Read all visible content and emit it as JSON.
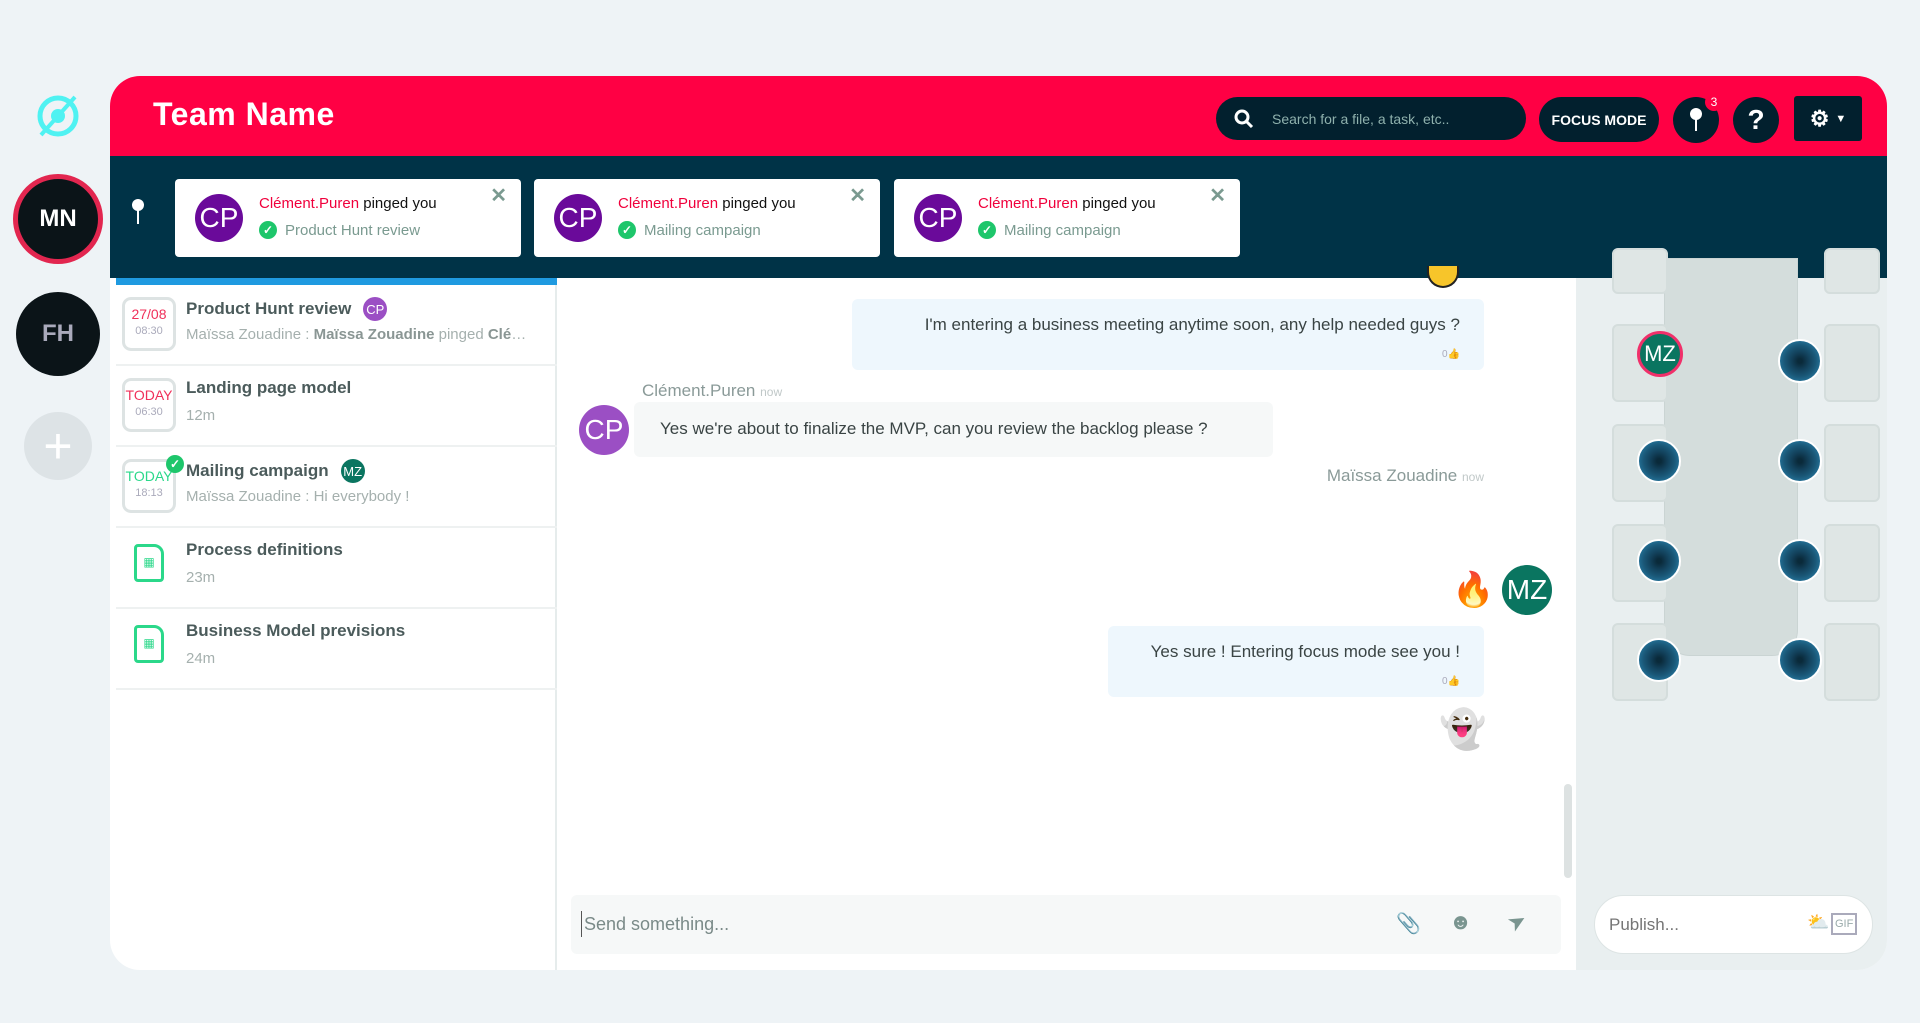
{
  "rail": {
    "workspaces": [
      {
        "initials": "MN",
        "active": true
      },
      {
        "initials": "FH",
        "active": false
      }
    ],
    "add_label": "+"
  },
  "header": {
    "title": "Team Name",
    "search_placeholder": "Search for a file, a task, etc..",
    "focus_label": "FOCUS MODE",
    "ping_count": "3",
    "help_label": "?"
  },
  "pings": [
    {
      "initials": "CP",
      "user": "Clément.Puren",
      "action": "pinged you",
      "topic": "Product Hunt review"
    },
    {
      "initials": "CP",
      "user": "Clément.Puren",
      "action": "pinged you",
      "topic": "Mailing campaign"
    },
    {
      "initials": "CP",
      "user": "Clément.Puren",
      "action": "pinged you",
      "topic": "Mailing campaign"
    }
  ],
  "list": [
    {
      "date": "27/08",
      "time": "08:30",
      "title": "Product Hunt review",
      "badge": "CP",
      "sub_user": "Maïssa Zouadine : ",
      "sub_bold": "Maïssa Zouadine",
      "sub_mid": " pinged ",
      "sub_end": "Clém..."
    },
    {
      "date": "TODAY",
      "time": "06:30",
      "title": "Landing page model",
      "sub": "12m"
    },
    {
      "date": "TODAY",
      "time": "18:13",
      "title": "Mailing campaign",
      "badge": "MZ",
      "sub": "Maïssa Zouadine : Hi everybody !"
    },
    {
      "title": "Process definitions",
      "sub": "23m"
    },
    {
      "title": "Business Model previsions",
      "sub": "24m"
    }
  ],
  "messages": [
    {
      "text": "I'm entering a business meeting anytime soon, any help needed guys ?",
      "likes": "0"
    },
    {
      "author": "Clément.Puren",
      "time": "now",
      "initials": "CP",
      "text": "Yes we're about to finalize the MVP, can you review the backlog please ?"
    },
    {
      "author": "Maïssa Zouadine",
      "time": "now",
      "initials": "MZ",
      "emoji": "🔥"
    },
    {
      "text": "Yes sure ! Entering focus mode see you !",
      "likes": "0",
      "emoji": "👻"
    }
  ],
  "composer": {
    "placeholder": "Send something..."
  },
  "room": {
    "occupant": "MZ",
    "publish_placeholder": "Publish...",
    "gif_label": "GIF"
  },
  "colors": {
    "brand": "#ff0044",
    "dark": "#003347",
    "cp": "#9b4fc4",
    "mz": "#0a7560"
  }
}
